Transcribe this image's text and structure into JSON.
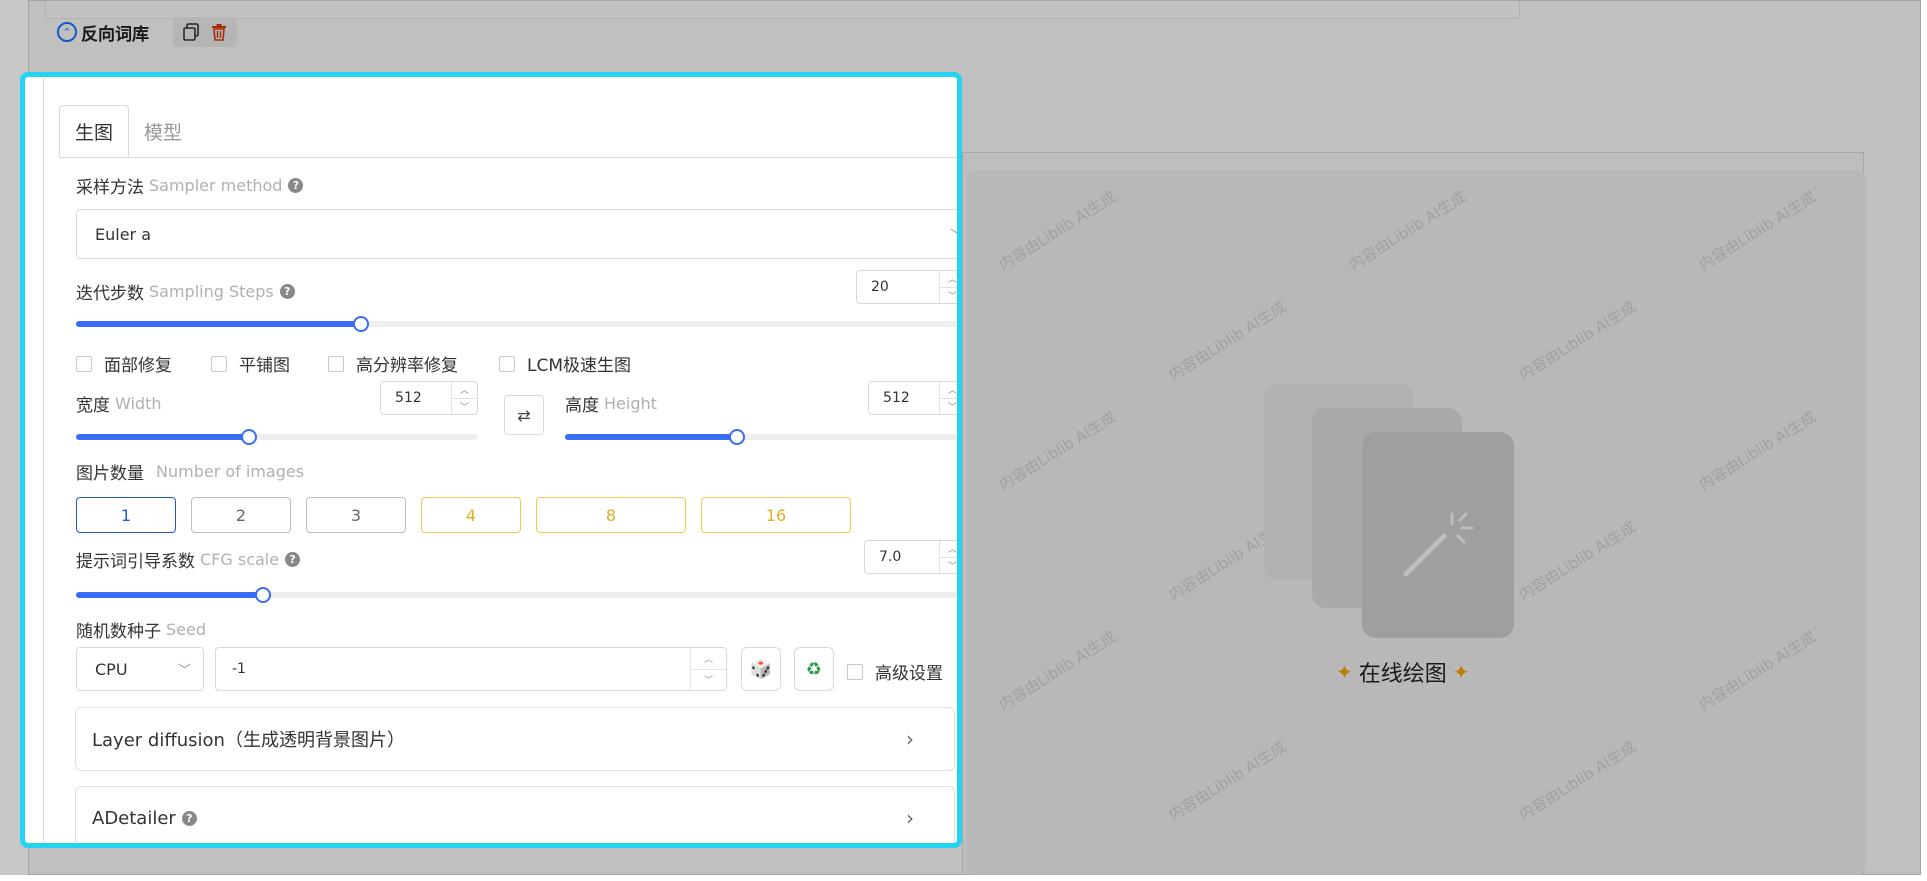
{
  "negative_library": {
    "title": "反向词库",
    "icons": [
      "copy-icon",
      "trash-icon"
    ]
  },
  "panel": {
    "tabs": [
      {
        "label": "生图",
        "active": true
      },
      {
        "label": "模型",
        "active": false
      }
    ],
    "sampler": {
      "label": "采样方法",
      "sub_label": "Sampler method",
      "value": "Euler a"
    },
    "steps": {
      "label": "迭代步数",
      "sub_label": "Sampling Steps",
      "value": "20",
      "fraction": 0.32
    },
    "options": [
      {
        "label": "面部修复",
        "checked": false
      },
      {
        "label": "平铺图",
        "checked": false
      },
      {
        "label": "高分辨率修复",
        "checked": false
      },
      {
        "label": "LCM极速生图",
        "checked": false
      }
    ],
    "width": {
      "label": "宽度",
      "sub_label": "Width",
      "value": "512",
      "fraction": 0.43
    },
    "height": {
      "label": "高度",
      "sub_label": "Height",
      "value": "512",
      "fraction": 0.43
    },
    "num_images": {
      "label": "图片数量",
      "sub_label": "Number of images",
      "choices": [
        "1",
        "2",
        "3",
        "4",
        "8",
        "16"
      ],
      "selected": "1"
    },
    "cfg": {
      "label": "提示词引导系数",
      "sub_label": "CFG scale",
      "value": "7.0",
      "fraction": 0.21
    },
    "seed": {
      "label": "随机数种子",
      "sub_label": "Seed",
      "device": "CPU",
      "value": "-1",
      "advanced_label": "高级设置"
    },
    "layer_diffusion": {
      "label": "Layer diffusion（生成透明背景图片）"
    },
    "adetailer": {
      "label": "ADetailer"
    }
  },
  "preview": {
    "button_label": "在线绘图",
    "watermark": "内容由Liblib AI生成"
  },
  "colors": {
    "highlight_border": "#21d4f2",
    "accent": "#3a6cf4",
    "gold": "#f2c94c"
  }
}
